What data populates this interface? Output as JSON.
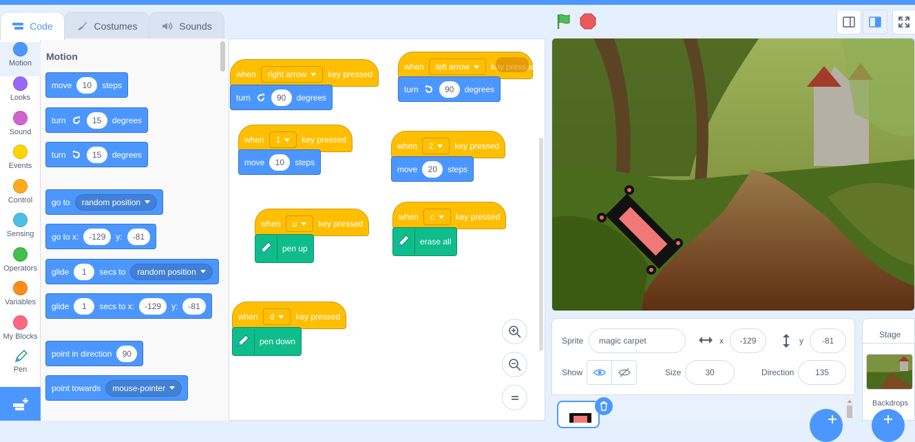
{
  "tabs": {
    "code": "Code",
    "costumes": "Costumes",
    "sounds": "Sounds"
  },
  "categories": [
    {
      "label": "Motion",
      "color": "#4c97ff"
    },
    {
      "label": "Looks",
      "color": "#9966ff"
    },
    {
      "label": "Sound",
      "color": "#cf63cf"
    },
    {
      "label": "Events",
      "color": "#ffd500"
    },
    {
      "label": "Control",
      "color": "#ffab19"
    },
    {
      "label": "Sensing",
      "color": "#4cbfe6"
    },
    {
      "label": "Operators",
      "color": "#40bf4a"
    },
    {
      "label": "Variables",
      "color": "#ff8c1a"
    },
    {
      "label": "My Blocks",
      "color": "#ff6680"
    },
    {
      "label": "Pen",
      "color": "#0fbd8c"
    }
  ],
  "palette": {
    "title": "Motion",
    "move": {
      "a": "move",
      "v": "10",
      "b": "steps"
    },
    "turn_right": {
      "a": "turn",
      "v": "15",
      "b": "degrees"
    },
    "turn_left": {
      "a": "turn",
      "v": "15",
      "b": "degrees"
    },
    "goto": {
      "a": "go to",
      "dd": "random position"
    },
    "gotoxy": {
      "a": "go to x:",
      "x": "-129",
      "b": "y:",
      "y": "-81"
    },
    "glide1": {
      "a": "glide",
      "v": "1",
      "b": "secs to",
      "dd": "random position"
    },
    "glide2": {
      "a": "glide",
      "v": "1",
      "b": "secs to x:",
      "x": "-129",
      "c": "y:",
      "y": "-81"
    },
    "point_dir": {
      "a": "point in direction",
      "v": "90"
    },
    "point_towards": {
      "a": "point towards",
      "dd": "mouse-pointer"
    }
  },
  "workspace": {
    "s1": {
      "when": "when",
      "key": "right arrow",
      "pressed": "key pressed",
      "a": "turn",
      "v": "90",
      "b": "degrees"
    },
    "s2": {
      "when": "when",
      "key": "left arrow",
      "pressed": "key pressed",
      "a": "turn",
      "v": "90",
      "b": "degrees"
    },
    "s3": {
      "when": "when",
      "key": "1",
      "pressed": "key pressed",
      "a": "move",
      "v": "10",
      "b": "steps"
    },
    "s4": {
      "when": "when",
      "key": "2",
      "pressed": "key pressed",
      "a": "move",
      "v": "20",
      "b": "steps"
    },
    "s5": {
      "when": "when",
      "key": "u",
      "pressed": "key pressed",
      "a": "pen up"
    },
    "s6": {
      "when": "when",
      "key": "c",
      "pressed": "key pressed",
      "a": "erase all"
    },
    "s7": {
      "when": "when",
      "key": "d",
      "pressed": "key pressed",
      "a": "pen down"
    }
  },
  "sprite": {
    "label": "Sprite",
    "name": "magic carpet",
    "x_label": "x",
    "x": "-129",
    "y_label": "y",
    "y": "-81",
    "show_label": "Show",
    "size_label": "Size",
    "size": "30",
    "direction_label": "Direction",
    "direction": "135"
  },
  "stage_panel": {
    "title": "Stage",
    "backdrops": "Backdrops"
  }
}
